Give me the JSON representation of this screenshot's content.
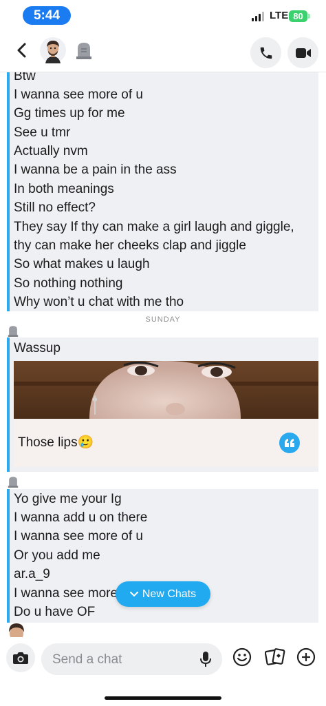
{
  "status_bar": {
    "time": "5:44",
    "network": "LTE",
    "battery": "80"
  },
  "header": {
    "back_icon": "chevron-left-icon",
    "avatar_icon": "bitmoji-avatar-icon",
    "tombstone_icon": "tombstone-icon",
    "call_icon": "phone-icon",
    "video_icon": "video-camera-icon"
  },
  "messages_group1": [
    "Btw",
    "I wanna see more of u",
    "Gg times up for me",
    "See u tmr",
    "Actually nvm",
    "I wanna be a pain in the ass",
    "In both meanings",
    "Still no effect?",
    "They say  If thy can make a girl laugh and giggle,",
    "thy can make her cheeks clap and jiggle",
    "So what makes u laugh",
    "So nothing nothing",
    "Why won’t u chat with me tho"
  ],
  "day_separator": "SUNDAY",
  "snap_block": {
    "text": "Wassup",
    "caption": "Those lips",
    "caption_emoji": "🥲",
    "quote_icon": "quote-icon"
  },
  "messages_group2": [
    "Yo give me your Ig",
    "I wanna add u on there",
    "I wanna see more of u",
    "Or you add me",
    "ar.a_9",
    "I wanna see more",
    "Do u have OF"
  ],
  "new_chats_button": "New Chats",
  "composer": {
    "placeholder": "Send a chat",
    "camera_icon": "camera-icon",
    "mic_icon": "microphone-icon",
    "bitmoji_icon": "smiley-icon",
    "cards_icon": "cards-icon",
    "plus_icon": "plus-icon"
  },
  "colors": {
    "accent": "#2aa9ee",
    "time_pill": "#1a7cf0",
    "battery": "#3bd16f"
  }
}
